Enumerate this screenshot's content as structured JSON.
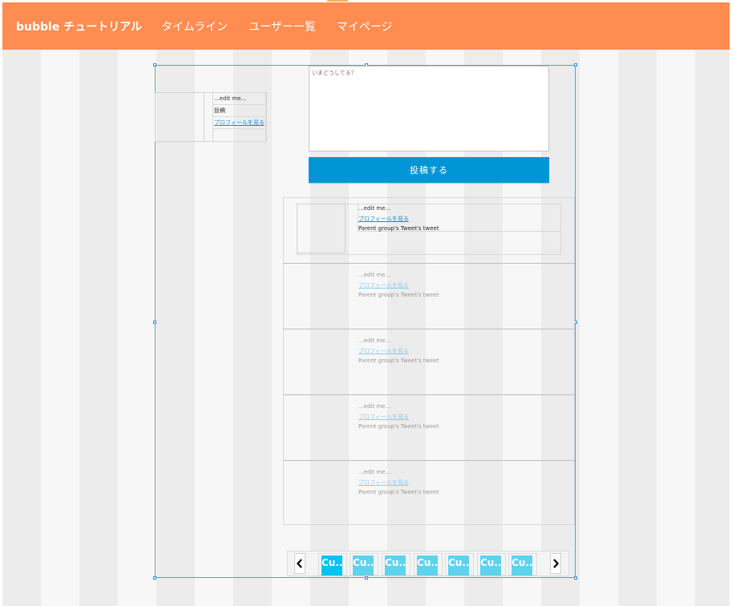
{
  "header": {
    "brand": "bubble チュートリアル",
    "nav": [
      "タイムライン",
      "ユーザー一覧",
      "マイページ"
    ],
    "bg_color": "#ff8c50"
  },
  "user_card": {
    "name": "...edit me...",
    "posts_label": "投稿",
    "profile_link": "プロフィールを見る"
  },
  "post_form": {
    "placeholder": "いまどうしてる？",
    "submit_label": "投稿する",
    "button_color": "#0096d6"
  },
  "tweets": [
    {
      "name": "...edit me...",
      "profile_link": "プロフィールを見る",
      "body": "Parent group's Tweet's tweet"
    },
    {
      "name": "...edit me...",
      "profile_link": "プロフィールを見る",
      "body": "Parent group's Tweet's tweet"
    },
    {
      "name": "...edit me...",
      "profile_link": "プロフィールを見る",
      "body": "Parent group's Tweet's tweet"
    },
    {
      "name": "...edit me...",
      "profile_link": "プロフィールを見る",
      "body": "Parent group's Tweet's tweet"
    },
    {
      "name": "...edit me...",
      "profile_link": "プロフィールを見る",
      "body": "Parent group's Tweet's tweet"
    }
  ],
  "pagination": {
    "prev_icon": "chevron-left-icon",
    "next_icon": "chevron-right-icon",
    "items": [
      "Cu..",
      "Cu..",
      "Cu..",
      "Cu..",
      "Cu..",
      "Cu..",
      "Cu.."
    ],
    "active_index": 0,
    "active_color": "#00c3f0",
    "item_color": "#5fd2ee"
  }
}
